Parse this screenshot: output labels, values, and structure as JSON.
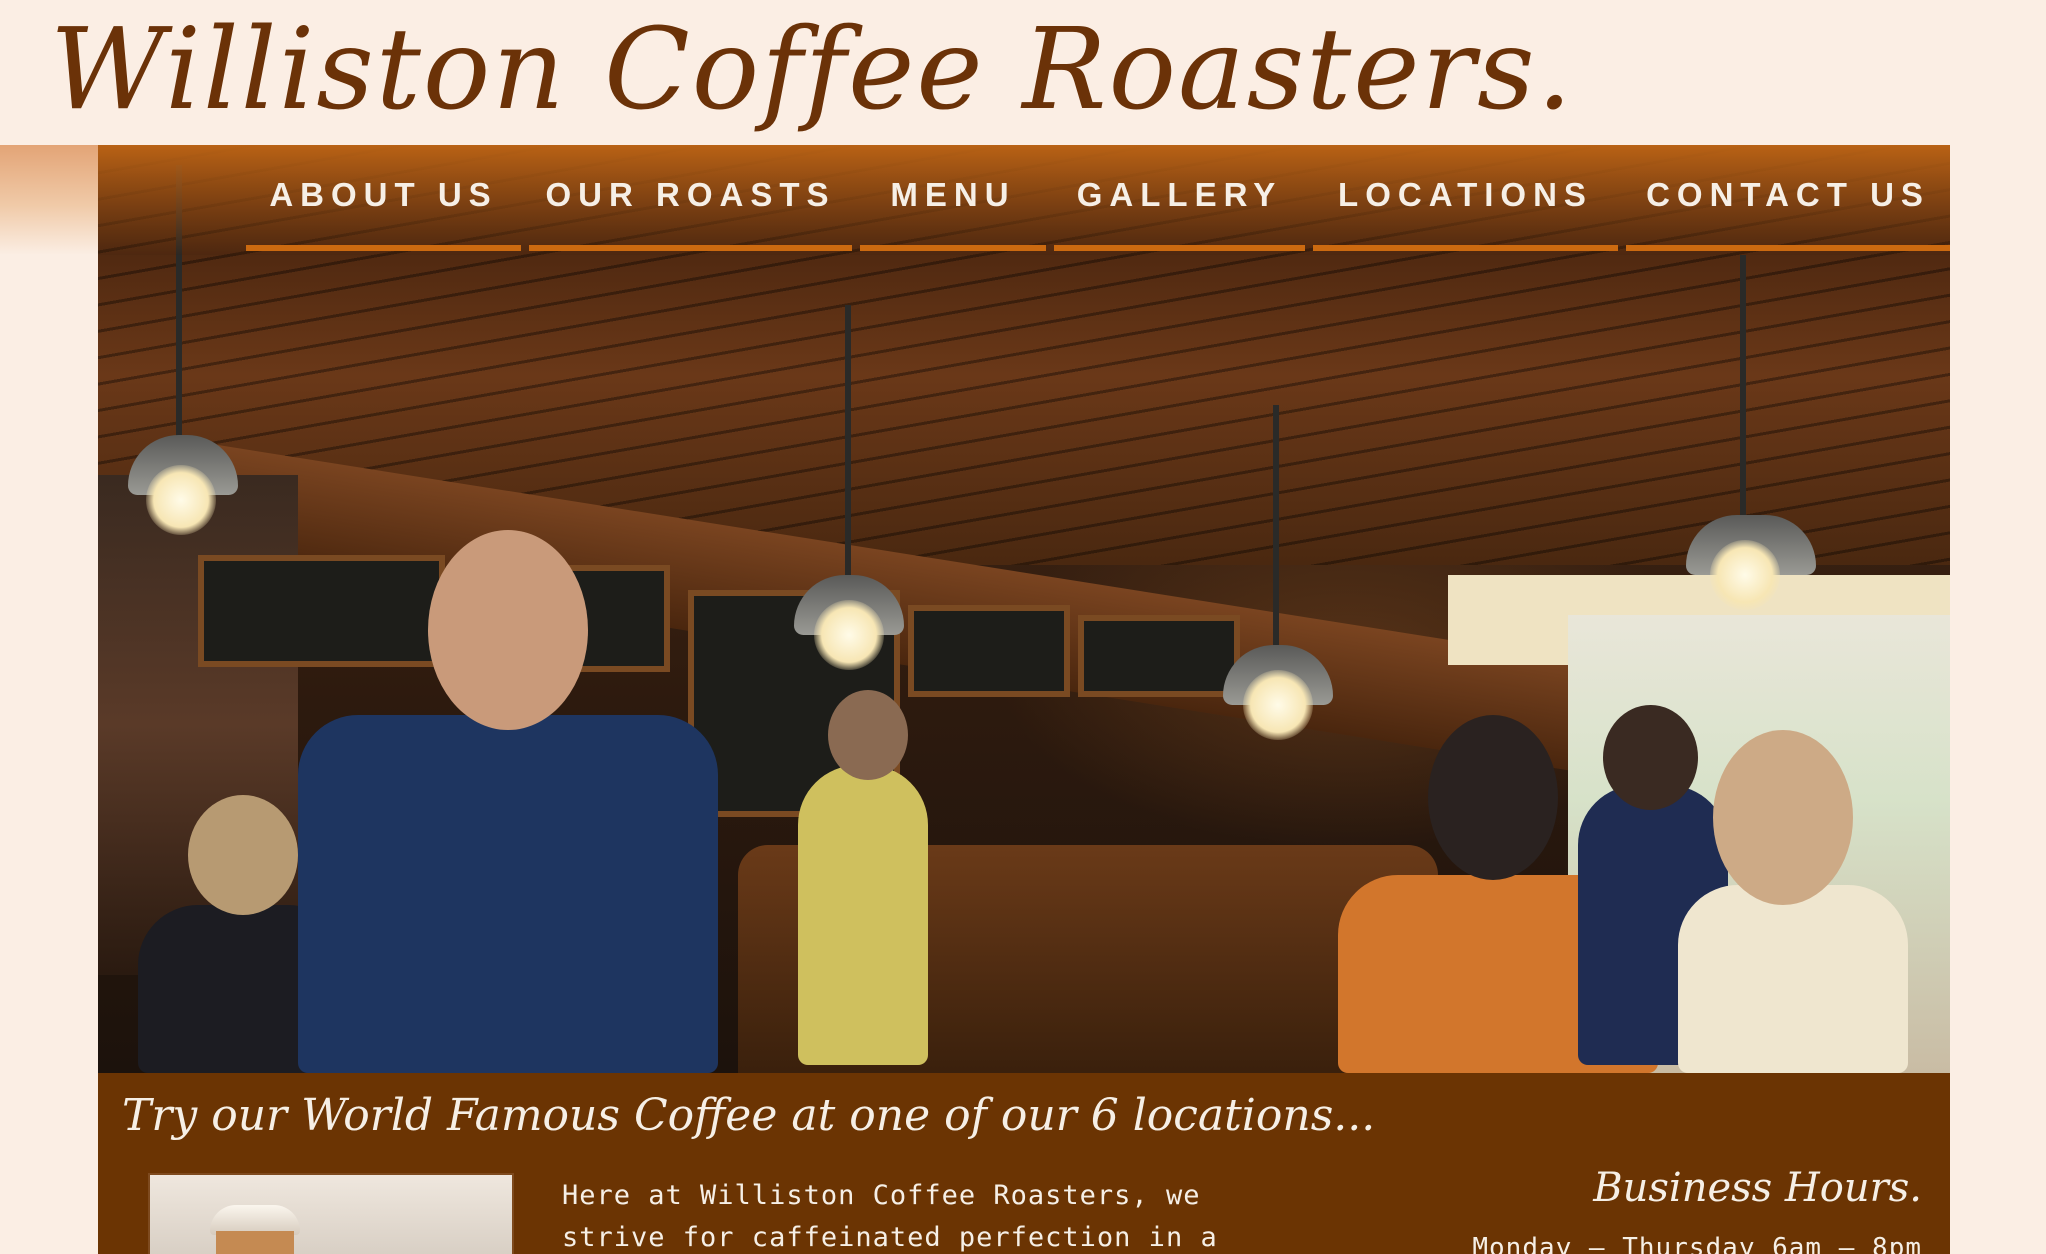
{
  "site": {
    "title": "Williston Coffee Roasters."
  },
  "nav": {
    "items": [
      {
        "label": "ABOUT US"
      },
      {
        "label": "OUR ROASTS"
      },
      {
        "label": "MENU"
      },
      {
        "label": "GALLERY"
      },
      {
        "label": "LOCATIONS"
      },
      {
        "label": "CONTACT US"
      }
    ]
  },
  "main": {
    "tagline": "Try our World Famous Coffee at one of our 6 locations...",
    "intro_text": "Here at Williston Coffee Roasters, we strive for caffeinated perfection in a casual and",
    "hours_title": "Business Hours.",
    "hours_line": "Monday – Thursday 6am – 8pm"
  },
  "colors": {
    "header_text": "#6b3208",
    "page_bg": "#fbeee4",
    "panel_bg": "#6b3403",
    "nav_underline": "#cc6a10",
    "light_text": "#f6efe6"
  }
}
